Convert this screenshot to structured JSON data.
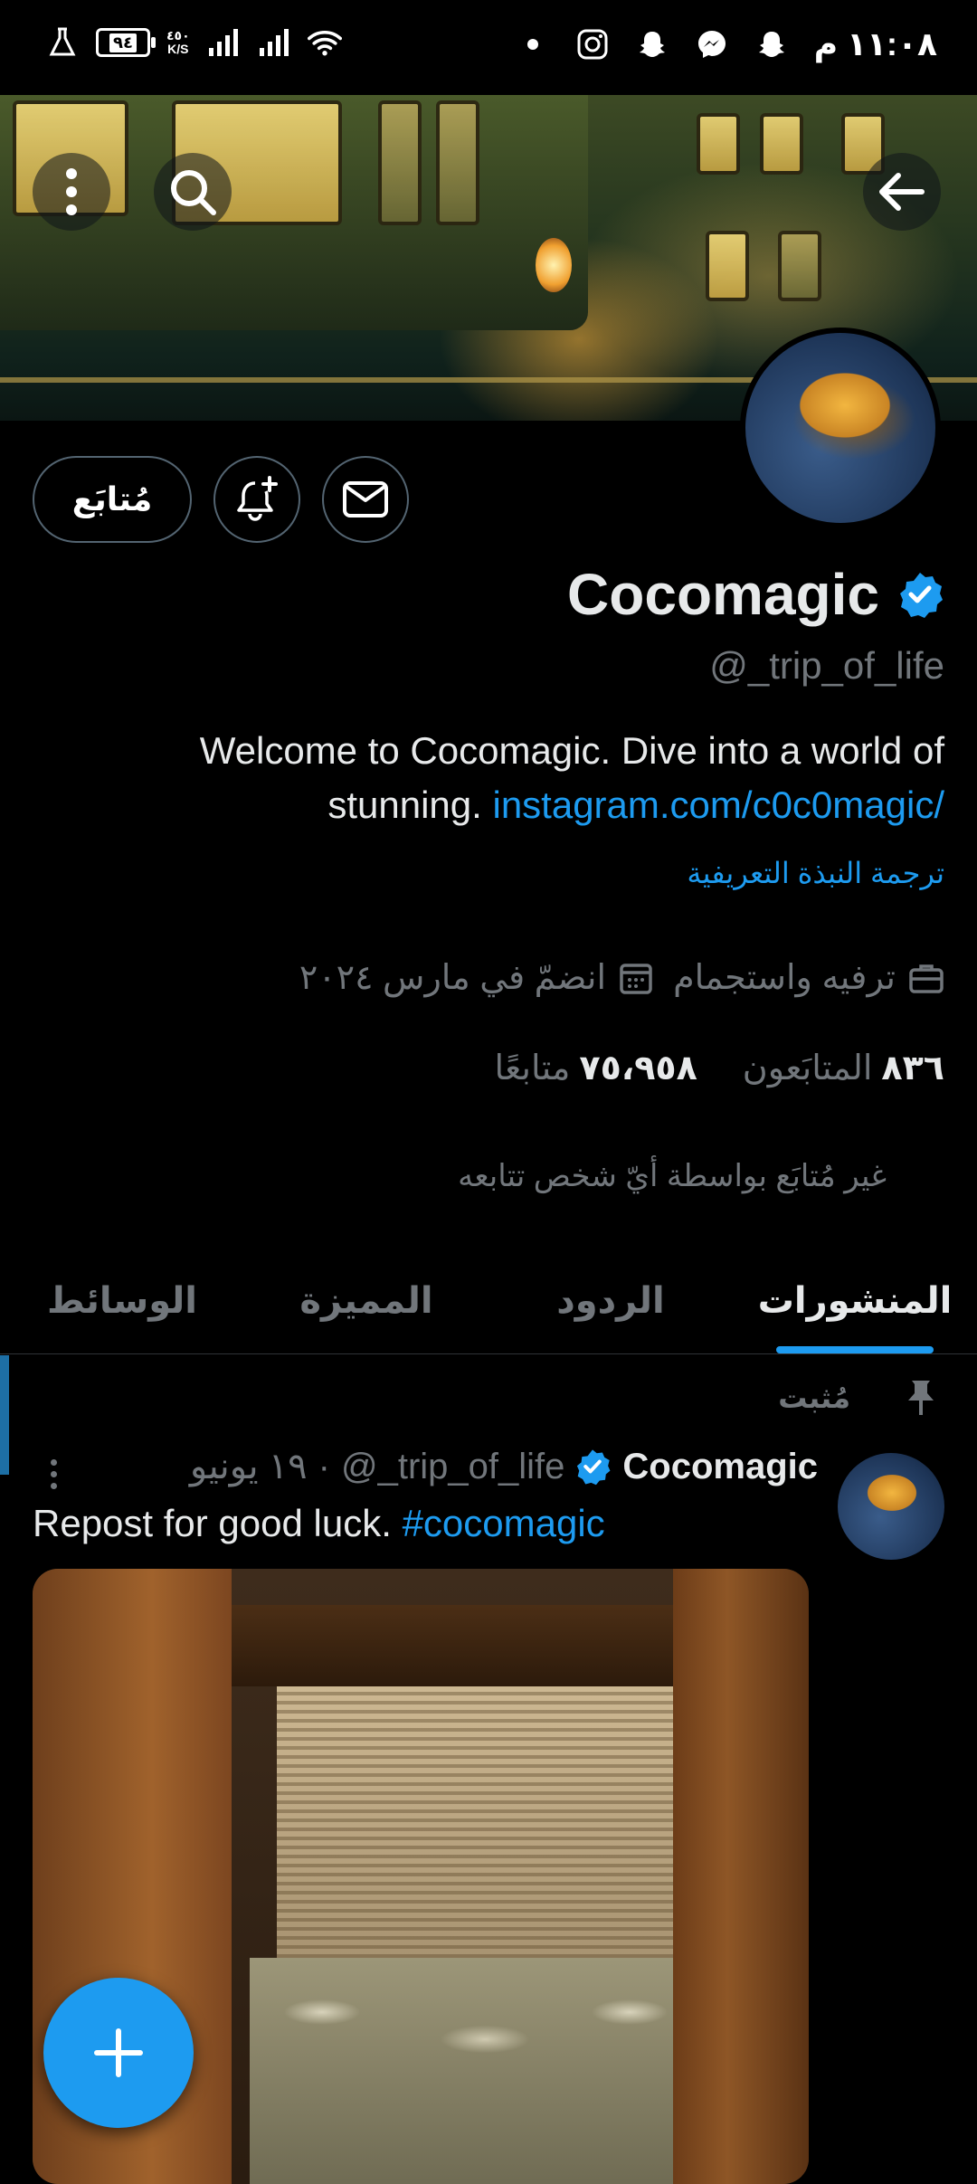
{
  "status_bar": {
    "time": "١١:٠٨ م",
    "battery": "٩٤",
    "speed_value": "٤٥٠",
    "speed_unit": "K/S",
    "icons": [
      "flask-icon",
      "battery-icon",
      "signal-icon",
      "signal-icon",
      "wifi-icon",
      "dot-icon",
      "instagram-icon",
      "snapchat-icon",
      "messenger-icon",
      "snapchat-icon"
    ]
  },
  "banner": {
    "back_icon": "arrow-left-icon",
    "search_icon": "search-icon",
    "more_icon": "more-vertical-icon"
  },
  "profile": {
    "display_name": "Cocomagic",
    "handle": "@_trip_of_life",
    "verified": true,
    "bio_text": "Welcome to Cocomagic. Dive into a world of stunning.",
    "bio_link": "instagram.com/c0c0magic/",
    "translate_bio": "ترجمة النبذة التعريفية",
    "category": "ترفيه واستجمام",
    "joined": "انضمّ في مارس ٢٠٢٤",
    "following_count": "٨٣٦",
    "following_label": "المتابَعون",
    "followers_count": "٧٥،٩٥٨",
    "followers_label": "متابعًا",
    "not_followed_note": "غير مُتابَع بواسطة أيّ شخص تتابعه"
  },
  "actions": {
    "follow_label": "مُتابَع",
    "notify_icon": "bell-plus-icon",
    "message_icon": "mail-icon"
  },
  "tabs": [
    {
      "label": "المنشورات",
      "active": true
    },
    {
      "label": "الردود",
      "active": false
    },
    {
      "label": "المميزة",
      "active": false
    },
    {
      "label": "الوسائط",
      "active": false
    }
  ],
  "post": {
    "pinned_label": "مُثبت",
    "author": "Cocomagic",
    "handle": "@_trip_of_life",
    "separator": "·",
    "date": "١٩ يونيو",
    "text": "Repost for good luck.",
    "hashtag": "#cocomagic"
  },
  "fab": {
    "icon": "plus-icon"
  },
  "colors": {
    "accent": "#1d9bf0",
    "background": "#000000",
    "secondary_text": "#71767b",
    "primary_text": "#e7e9ea"
  }
}
